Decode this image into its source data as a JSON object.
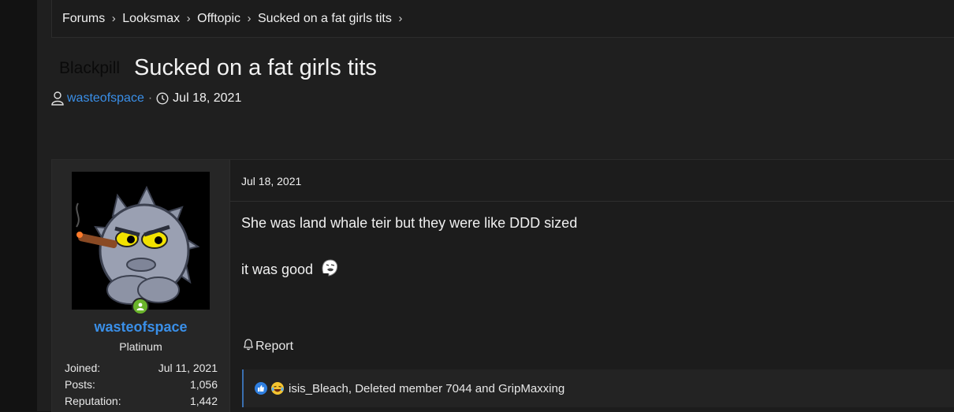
{
  "breadcrumb": [
    "Forums",
    "Looksmax",
    "Offtopic",
    "Sucked on a fat girls tits"
  ],
  "thread": {
    "prefix": "Blackpill",
    "title": "Sucked on a fat girls tits",
    "author": "wasteofspace",
    "date": "Jul 18, 2021"
  },
  "user": {
    "name": "wasteofspace",
    "title": "Platinum",
    "stats": [
      {
        "label": "Joined:",
        "value": "Jul 11, 2021"
      },
      {
        "label": "Posts:",
        "value": "1,056"
      },
      {
        "label": "Reputation:",
        "value": "1,442"
      }
    ]
  },
  "post": {
    "date": "Jul 18, 2021",
    "line1": "She was land whale teir but they were like DDD sized",
    "line2": "it was good",
    "report_label": "Report",
    "reactions_text": "isis_Bleach, Deleted member 7044 and GripMaxxing"
  },
  "colors": {
    "link": "#3a8fe8",
    "online": "#6ab42b",
    "background": "#1f1f1f"
  },
  "icons": [
    "chevron-right-icon",
    "user-icon",
    "clock-icon",
    "online-icon",
    "bell-icon",
    "like-icon",
    "cry-laugh-icon"
  ]
}
